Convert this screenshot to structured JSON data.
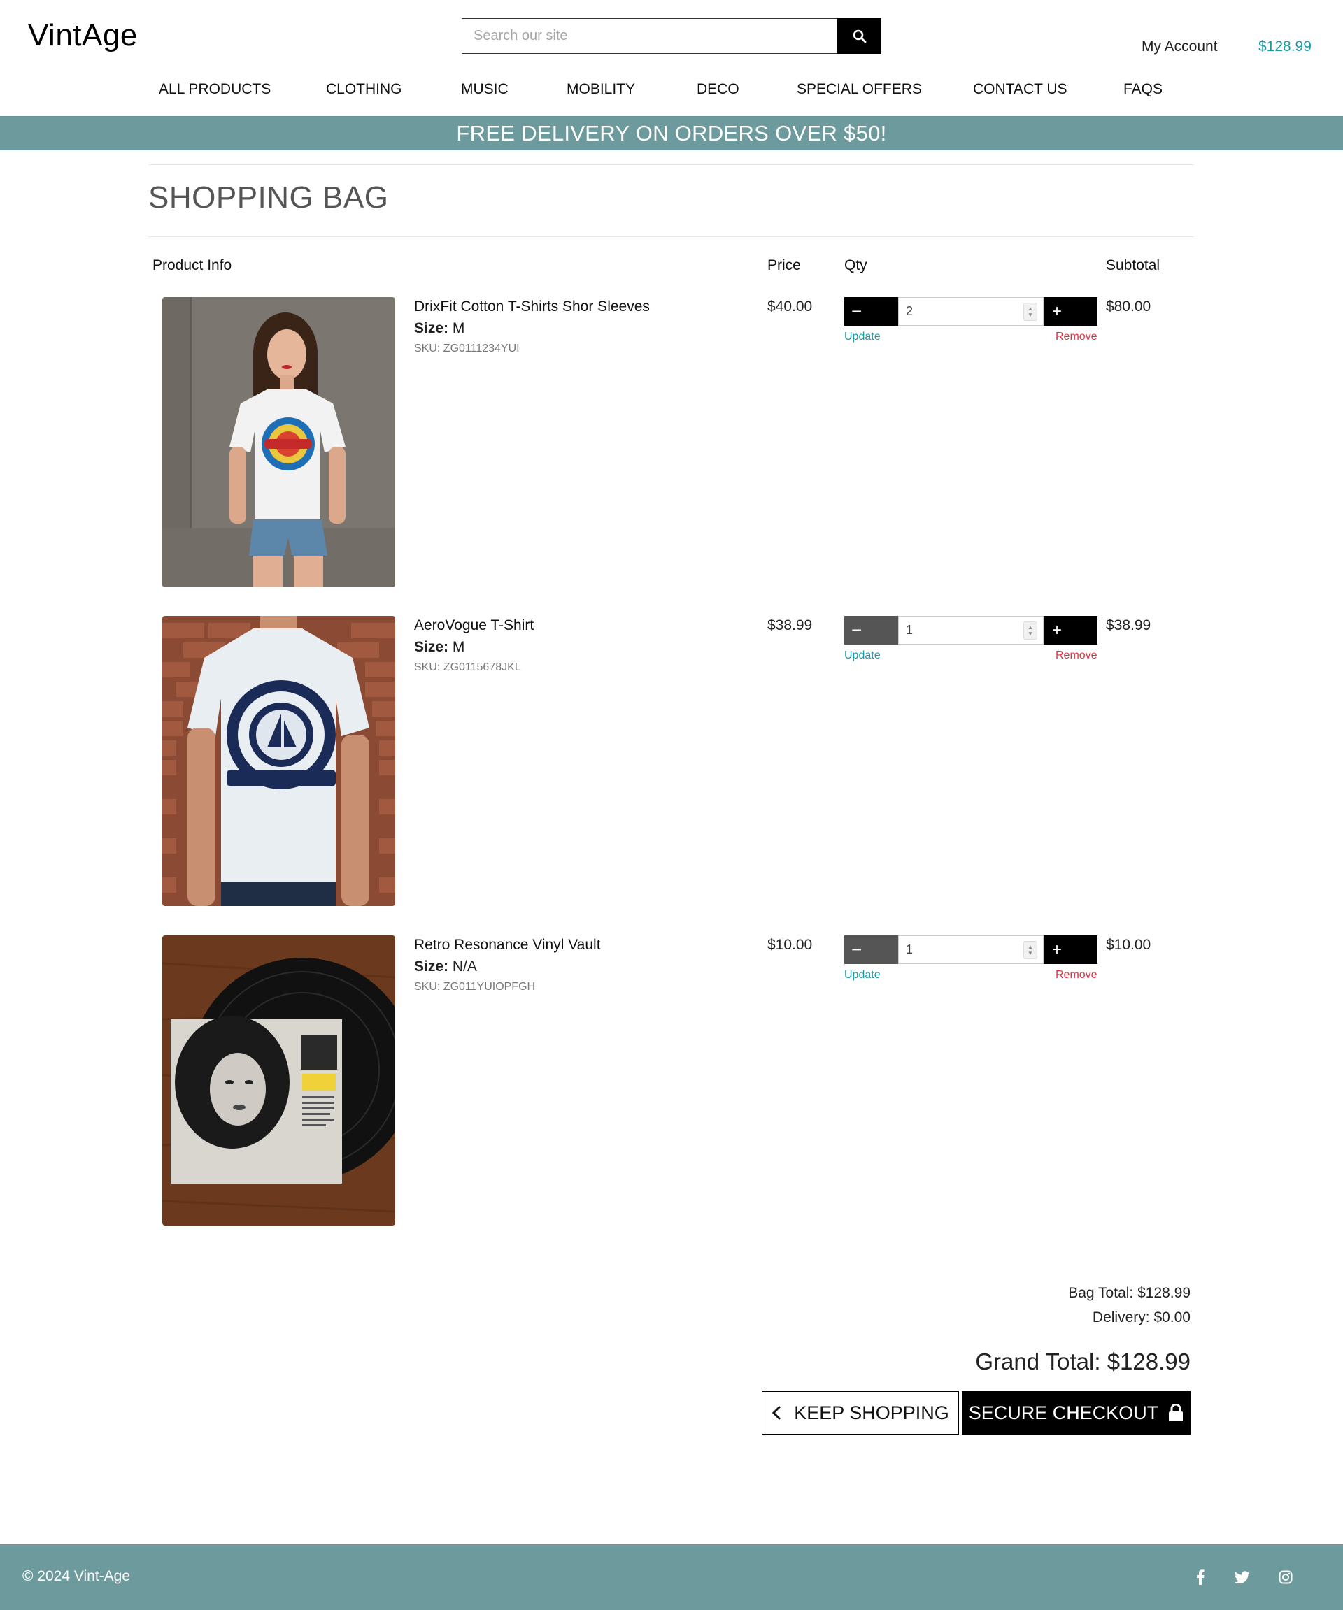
{
  "header": {
    "logo": "VintAge",
    "search_placeholder": "Search our site",
    "account_label": "My Account",
    "cart_total": "$128.99"
  },
  "nav": [
    "ALL PRODUCTS",
    "CLOTHING",
    "MUSIC",
    "MOBILITY",
    "DECO",
    "SPECIAL OFFERS",
    "CONTACT US",
    "FAQS"
  ],
  "banner": "FREE DELIVERY ON ORDERS OVER $50!",
  "page_title": "SHOPPING BAG",
  "columns": {
    "product_info": "Product Info",
    "price": "Price",
    "qty": "Qty",
    "subtotal": "Subtotal"
  },
  "items": [
    {
      "name": "DrixFit Cotton T-Shirts Shor Sleeves",
      "size_label": "Size:",
      "size": "M",
      "sku": "SKU: ZG0111234YUI",
      "price": "$40.00",
      "qty": "2",
      "subtotal": "$80.00",
      "update": "Update",
      "remove": "Remove",
      "minus_enabled": true
    },
    {
      "name": "AeroVogue T-Shirt",
      "size_label": "Size:",
      "size": "M",
      "sku": "SKU: ZG0115678JKL",
      "price": "$38.99",
      "qty": "1",
      "subtotal": "$38.99",
      "update": "Update",
      "remove": "Remove",
      "minus_enabled": false
    },
    {
      "name": "Retro Resonance Vinyl Vault",
      "size_label": "Size:",
      "size": "N/A",
      "sku": "SKU: ZG011YUIOPFGH",
      "price": "$10.00",
      "qty": "1",
      "subtotal": "$10.00",
      "update": "Update",
      "remove": "Remove",
      "minus_enabled": false
    }
  ],
  "totals": {
    "bag_total": "Bag Total: $128.99",
    "delivery": "Delivery: $0.00",
    "grand_total": "Grand Total: $128.99"
  },
  "buttons": {
    "keep_shopping": "KEEP SHOPPING",
    "secure_checkout": "SECURE CHECKOUT"
  },
  "footer": {
    "copyright": "© 2024 Vint-Age",
    "social": [
      "facebook-icon",
      "twitter-icon",
      "instagram-icon"
    ]
  },
  "colors": {
    "accent": "#1a9aa6",
    "banner": "#6d9a9c",
    "remove": "#dc3545",
    "button_dark": "#000000",
    "button_disabled": "#555555"
  }
}
